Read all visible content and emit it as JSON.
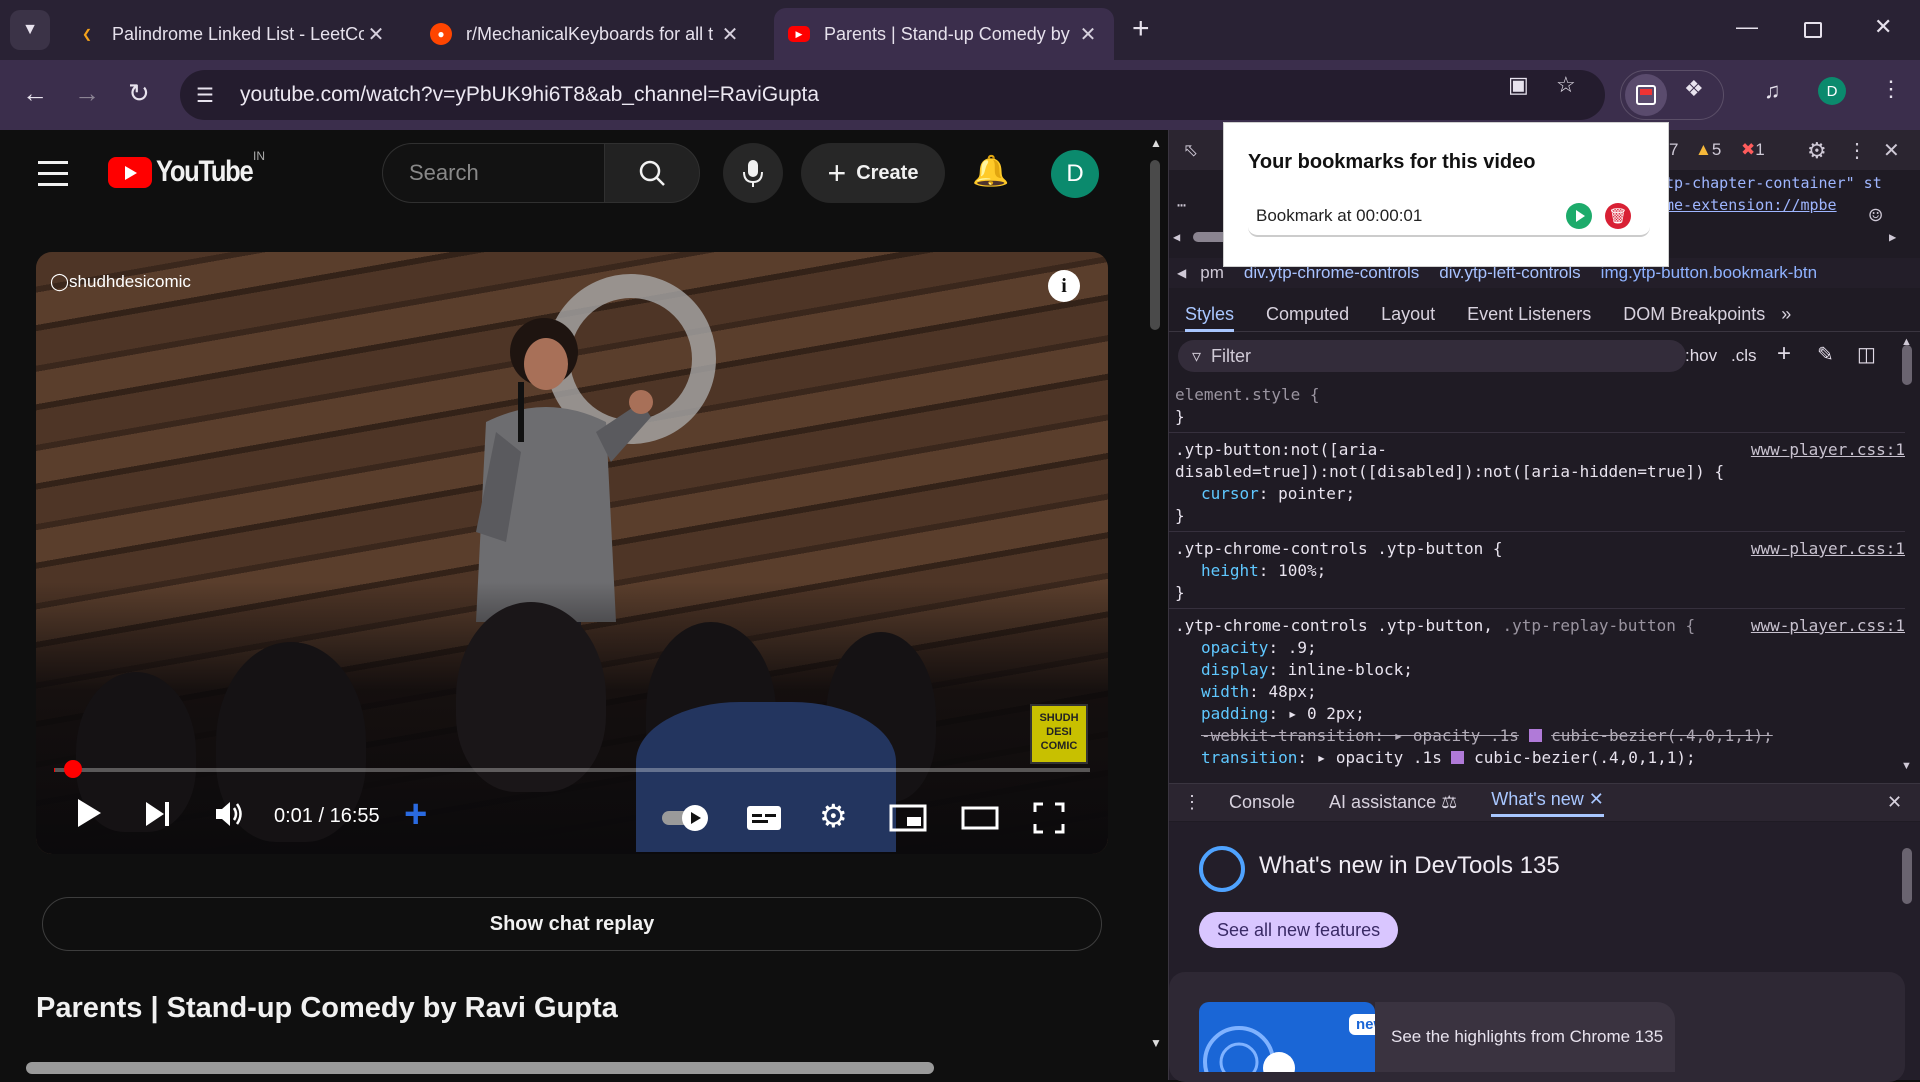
{
  "browser": {
    "tabs": [
      {
        "title": "Palindrome Linked List - LeetCo",
        "icon": "leetcode-icon",
        "active": false
      },
      {
        "title": "r/MechanicalKeyboards for all t",
        "icon": "reddit-icon",
        "active": false
      },
      {
        "title": "Parents | Stand-up Comedy by",
        "icon": "youtube-icon",
        "active": true
      }
    ],
    "url": "youtube.com/watch?v=yPbUK9hi6T8&ab_channel=RaviGupta",
    "profile_initial": "D",
    "accent": "#3b2e4c"
  },
  "youtube": {
    "logo_text": "YouTube",
    "country": "IN",
    "search_placeholder": "Search",
    "create_label": "Create",
    "avatar_initial": "D",
    "player": {
      "watermark_handle": "shudhdesicomic",
      "channel_badge": "SHUDH DESI COMIC",
      "time": "0:01 / 16:55",
      "progress_fraction": 0.001
    },
    "chat_replay_label": "Show chat replay",
    "video_title": "Parents | Stand-up Comedy by Ravi Gupta"
  },
  "devtools": {
    "top_counts": {
      "warnings_left": "7",
      "warnings": "5",
      "errors": "1"
    },
    "element_snippets": [
      "tp-chapter-container\" st",
      "me-extension://mpbe"
    ],
    "breadcrumbs": [
      "pm",
      "div.ytp-chrome-controls",
      "div.ytp-left-controls",
      "img.ytp-button.bookmark-btn"
    ],
    "panel_tabs": [
      "Styles",
      "Computed",
      "Layout",
      "Event Listeners",
      "DOM Breakpoints"
    ],
    "filter_placeholder": "Filter",
    "hov": ":hov",
    "cls": ".cls",
    "drawer_tabs": [
      "Console",
      "AI assistance",
      "What's new"
    ],
    "whats_new_title": "What's new in DevTools 135",
    "whats_new_button": "See all new features",
    "new_badge": "new",
    "highlights": "See the highlights from Chrome 135"
  },
  "css_rules": {
    "r0": {
      "sel": "element.style {",
      "close": "}"
    },
    "r1": {
      "sel": ".ytp-button:not([aria-",
      "sel2": "disabled=true]):not([disabled]):not([aria-hidden=true]) {",
      "src": "www-player.css:1",
      "p1": "cursor",
      "v1": "pointer;",
      "close": "}"
    },
    "r2": {
      "sel": ".ytp-chrome-controls .ytp-button {",
      "src": "www-player.css:1",
      "p1": "height",
      "v1": "100%;",
      "close": "}"
    },
    "r3": {
      "sel": ".ytp-chrome-controls .ytp-button,",
      "sel_dim": ".ytp-replay-button {",
      "src": "www-player.css:1",
      "p1": "opacity",
      "v1": ".9;",
      "p2": "display",
      "v2": "inline-block;",
      "p3": "width",
      "v3": "48px;",
      "p4": "padding",
      "v4": "0 2px;",
      "p5": "-webkit-transition",
      "v5": "opacity .1s",
      "v5b": "cubic-bezier(.4,0,1,1);",
      "p6": "transition",
      "v6": "opacity .1s",
      "v6b": "cubic-bezier(.4,0,1,1);"
    }
  },
  "bookmark_popup": {
    "title": "Your bookmarks for this video",
    "items": [
      {
        "label": "Bookmark at 00:00:01"
      }
    ]
  }
}
